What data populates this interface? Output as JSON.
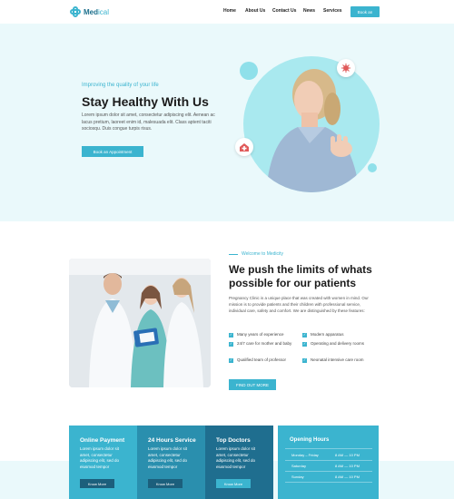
{
  "brand": {
    "name_part1": "Med",
    "name_part2": "ical"
  },
  "nav": {
    "items": [
      "Home",
      "About Us",
      "Contact Us",
      "News",
      "Services"
    ],
    "book_label": "Book an"
  },
  "hero": {
    "subtitle": "Improving the quality of your life",
    "title": "Stay Healthy With Us",
    "text": "Lorem ipsum dolor sit amet, consectetur adipiscing elit. Aenean ac lacus pretium, laoreet enim id, malesuada elit. Class aptent taciti sociosqu. Duis congue turpis risus.",
    "button": "Book an Appointment"
  },
  "about": {
    "eyebrow": "Welcome to Medicity",
    "title": "We push the limits of whats possible for our patients",
    "text": "Pregnancy Clinic is a unique place that was created with women in mind. Our mission is to provide patients and their children with professional service, individual care, safety and comfort. We are distinguished by these features:",
    "features": [
      "Many years of experience",
      "Modern apparatus",
      "24/7 care for mother and baby",
      "Operating and delivery rooms",
      "Qualified team of professor",
      "Neonatal intensive care room"
    ],
    "button": "FIND OUT MORE"
  },
  "services": [
    {
      "title": "Online Payment",
      "text": "Lorem ipsum dolor sit amet, consectetur adipiscing elit, sed do eiusmod tempor",
      "button": "Know More"
    },
    {
      "title": "24 Hours Service",
      "text": "Lorem ipsum dolor sit amet, consectetur adipiscing elit, sed do eiusmod tempor",
      "button": "Know More"
    },
    {
      "title": "Top Doctors",
      "text": "Lorem ipsum dolor sit amet, consectetur adipiscing elit, sed do eiusmod tempor",
      "button": "Know More"
    }
  ],
  "hours": {
    "title": "Opening Hours",
    "rows": [
      {
        "day": "Monday – Friday",
        "time": "8 AM — 10 PM"
      },
      {
        "day": "Saturday",
        "time": "8 AM — 10 PM"
      },
      {
        "day": "Sunday",
        "time": "8 AM — 10 PM"
      }
    ]
  },
  "colors": {
    "accent": "#3bb4cf",
    "dark_accent": "#1d6f8c",
    "hero_bg": "#eaf9fb",
    "card1": "#3bb4cf",
    "card2": "#2a8fae",
    "card3": "#1f6e8f"
  },
  "icons": [
    "logo-cross-icon",
    "virus-icon",
    "medical-house-icon",
    "check-icon"
  ]
}
